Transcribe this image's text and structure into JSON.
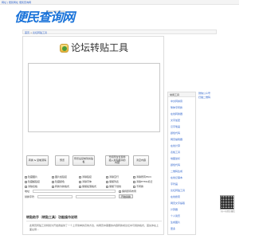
{
  "topbar": {
    "links": [
      "网址 | 便民网址",
      "便民查询网"
    ]
  },
  "header": {
    "logo_text": "便民查询网",
    "logo_url": "www.bmcx.com"
  },
  "breadcrumb": {
    "home": "首页",
    "sep": ">",
    "current": "论坛转贴工具"
  },
  "main": {
    "title": "论坛转贴工具",
    "buttons": [
      "转换 & 复制源码",
      "预览",
      "预览后复制到剪贴板",
      "光标所在位置前\n插入剪贴板中的\n内容",
      "清空内容"
    ],
    "options": [
      "隐藏图片",
      "图片加链接",
      "清除链接",
      "清除空行",
      "清除所有Html",
      "隐藏超链接",
      "隐藏颜色",
      "清除字体",
      "保留列表",
      "清除HTML标记",
      "清除表格",
      "转换为新格式",
      "保留段落格式",
      "保留下划线",
      "不转换"
    ],
    "address_label": "地址",
    "address_option": "保持原有布局",
    "replace_label": "替换字符",
    "replace_button": "开始替换"
  },
  "help": {
    "title": "转贴助手（转贴工具）功能操作说明",
    "text": "此网页转贴工具特别为开发者提供了一个上手简单的高效方法，将网页中需要的内容转换成论坛中可用的格式，首先你在上面左侧..."
  },
  "sidebar": {
    "heading": "常用工具",
    "items": [
      "中文转拼音",
      "繁体字转换",
      "在线转换器",
      "文字加密",
      "汉字笔画",
      "颜色代码",
      "网页编辑器",
      "在线计算",
      "表格工具",
      "地图坐标",
      "颜色代码",
      "二维码生成",
      "在线记事本",
      "字符画",
      "论坛转贴工具",
      "在线搜索",
      "网页文字提取",
      "计算器",
      "个人简历",
      "生成图片",
      "更多"
    ]
  },
  "qr_links": [
    "微信公众号",
    "扫描二维码"
  ],
  "fixed_qr": {
    "caption": "扫一扫关注微信"
  },
  "colors": {
    "brand": "#1a73d9",
    "link": "#3366cc"
  }
}
